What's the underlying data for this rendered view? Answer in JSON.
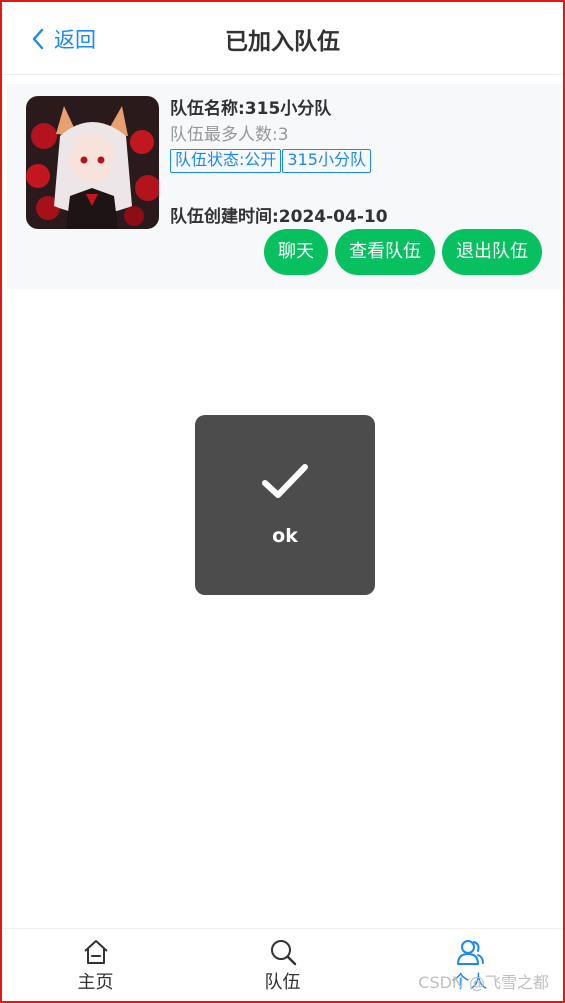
{
  "nav": {
    "back_label": "返回",
    "title": "已加入队伍"
  },
  "team": {
    "name": "队伍名称:315小分队",
    "max_members": "队伍最多人数:3",
    "tags": [
      "队伍状态:公开",
      "315小分队"
    ],
    "created": "队伍创建时间:2024-04-10",
    "buttons": {
      "chat": "聊天",
      "view": "查看队伍",
      "quit": "退出队伍"
    }
  },
  "toast": {
    "text": "ok",
    "icon": "checkmark-icon"
  },
  "tabbar": {
    "items": [
      {
        "label": "主页",
        "icon": "home-icon"
      },
      {
        "label": "队伍",
        "icon": "search-icon"
      },
      {
        "label": "个人",
        "icon": "user-icon"
      }
    ],
    "active_index": 2
  },
  "watermark": "CSDN @飞雪之都",
  "colors": {
    "primary": "#1989fa",
    "success": "#07c160",
    "frame": "#e01818"
  }
}
